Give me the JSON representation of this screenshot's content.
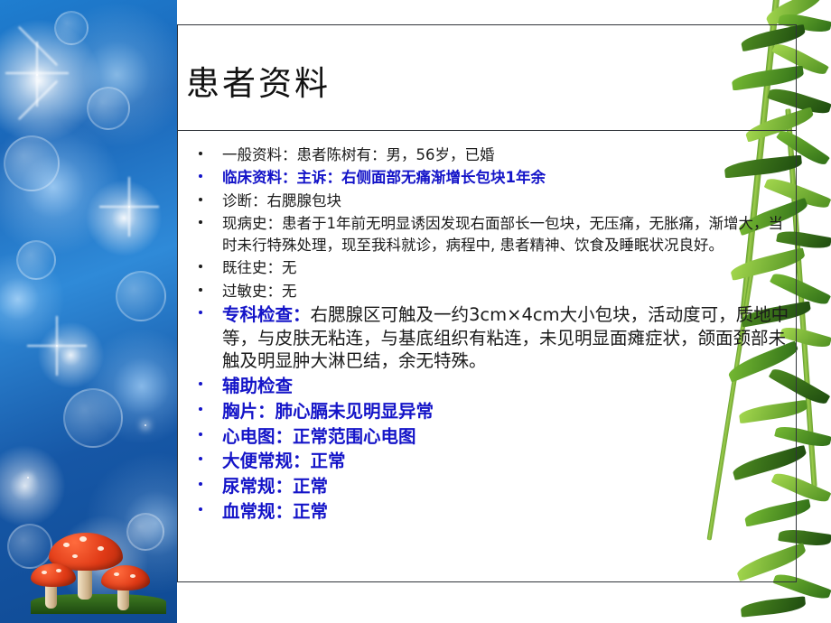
{
  "slide": {
    "title": "患者资料",
    "bullets": [
      {
        "style": "plain",
        "text": "一般资料：患者陈树有：男，56岁，已婚"
      },
      {
        "style": "mixed",
        "lead": "临床资料：",
        "text": "主诉：右侧面部无痛渐增长包块1年余"
      },
      {
        "style": "plain",
        "text": "诊断：右腮腺包块"
      },
      {
        "style": "plain",
        "text": "现病史：患者于1年前无明显诱因发现右面部长一包块，无压痛，无胀痛，渐增大，当时未行特殊处理，现至我科就诊，病程中, 患者精神、饮食及睡眠状况良好。"
      },
      {
        "style": "plain",
        "text": "既往史：无"
      },
      {
        "style": "plain",
        "text": "过敏史：无"
      },
      {
        "style": "mixed-big",
        "lead": "专科检查：",
        "text": "右腮腺区可触及一约3cm×4cm大小包块，活动度可，质地中等，与皮肤无粘连，与基底组织有粘连，未见明显面瘫症状，颌面颈部未触及明显肿大淋巴结，余无特殊。"
      },
      {
        "style": "blue-big",
        "text": "辅助检查"
      },
      {
        "style": "blue-big",
        "text": "胸片：肺心膈未见明显异常"
      },
      {
        "style": "blue-big",
        "text": "心电图：正常范围心电图"
      },
      {
        "style": "blue-big",
        "text": "大便常规：正常"
      },
      {
        "style": "blue-big",
        "text": "尿常规：正常"
      },
      {
        "style": "blue-big",
        "text": "血常规：正常"
      }
    ]
  },
  "decor": {
    "left_image": "blue-bokeh-photo",
    "right_image": "bamboo-leaves-photo",
    "foreground_image": "red-mushrooms"
  },
  "colors": {
    "accent_blue": "#1414c8",
    "text_dark": "#1b1b1b",
    "frame_border": "#30343a"
  }
}
